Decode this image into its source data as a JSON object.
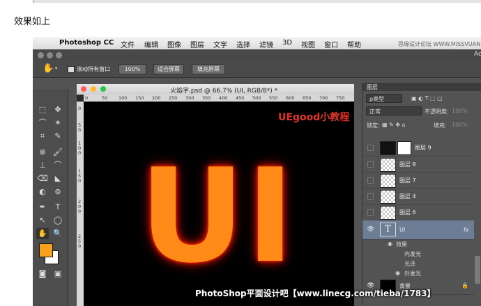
{
  "caption": "效果如上",
  "menubar": {
    "app_name": "Photoshop CC",
    "items": [
      "文件",
      "编辑",
      "图像",
      "图层",
      "文字",
      "选择",
      "滤镜",
      "3D",
      "视图",
      "窗口",
      "帮助"
    ],
    "watermark": "思缘设计论坛 WWW.MISSVUAN.COM",
    "right_text": "Ac"
  },
  "options": {
    "scroll_all_label": "滚动所有窗口",
    "btn_100": "100%",
    "btn_fit": "适合屏幕",
    "btn_fill": "填充屏幕"
  },
  "document": {
    "title": "火焰字.psd @ 66.7% (UI, RGB/8*) *",
    "ruler_h": [
      "0",
      "50",
      "100",
      "150",
      "200",
      "250",
      "300",
      "350",
      "400",
      "450",
      "500",
      "550",
      "600",
      "650",
      "700",
      "750"
    ],
    "ruler_v": [
      "0",
      "5",
      "0",
      "1",
      "0",
      "0",
      "1",
      "5",
      "0",
      "2",
      "0",
      "0",
      "2",
      "5",
      "0"
    ],
    "canvas_label": "UEgood小教程",
    "main_text": "UI",
    "footer_watermark": "PhotoShop平面设计吧【www.linecg.com/tieba/1783】"
  },
  "toolbox": {
    "tools": [
      "⬚",
      "✥",
      "⌒",
      "✶",
      "⌗",
      "✎",
      "⊗",
      "🖌",
      "⊥",
      "⌒",
      "⌫",
      "◣",
      "◐",
      "⊚",
      "✒",
      "T",
      "↖",
      "◯",
      "✋",
      "🔍"
    ],
    "fg_color": "#f7a21a",
    "bg_color": "#ffffff"
  },
  "layers": {
    "tab_label": "图层",
    "kind_label": "ρ类型",
    "blend_mode": "正常",
    "opacity_label": "不透明度:",
    "opacity_value": "100%",
    "lock_label": "锁定:",
    "fill_label": "填充:",
    "fill_value": "100%",
    "items": [
      {
        "name": "图层 9"
      },
      {
        "name": "图层 8"
      },
      {
        "name": "图层 7"
      },
      {
        "name": "图层 4"
      },
      {
        "name": "图层 6"
      },
      {
        "name": "UI"
      }
    ],
    "fx_label": "fx",
    "effects_label": "效果",
    "effects": [
      "内发光",
      "光泽",
      "外发光"
    ],
    "bottom_layer": "背景"
  },
  "colors": {
    "accent_orange": "#ff8a17",
    "glow_red": "#e01500",
    "label_red": "#e0322a",
    "selected_layer": "#6d7d95"
  }
}
